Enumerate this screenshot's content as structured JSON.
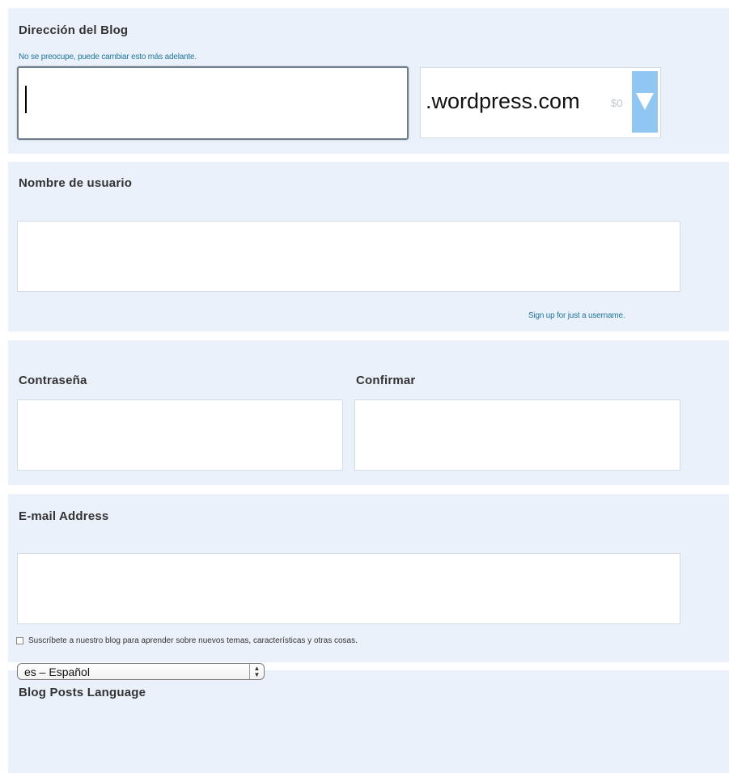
{
  "blog_address": {
    "label": "Dirección del Blog",
    "hint": "No se preocupe, puede cambiar esto más adelante.",
    "value": "",
    "domain_suffix": ".wordpress.com",
    "price": "$0"
  },
  "username": {
    "label": "Nombre de usuario",
    "value": "",
    "signup_link": "Sign up for just a username."
  },
  "password": {
    "label": "Contraseña",
    "confirm_label": "Confirmar",
    "value": "",
    "confirm_value": ""
  },
  "email": {
    "label": "E-mail Address",
    "value": "",
    "subscribe_label": "Suscríbete a nuestro blog para aprender sobre nuevos temas, características y otras cosas.",
    "subscribe_checked": false
  },
  "language": {
    "label": "Blog Posts Language",
    "selected": "es – Español"
  },
  "colors": {
    "panel_bg": "#ebf1fa",
    "link": "#21759b",
    "dropdown_button": "#8fc6f2"
  },
  "icons": {
    "dropdown": "triangle-down-icon",
    "select_arrows": "updown-arrows-icon"
  }
}
